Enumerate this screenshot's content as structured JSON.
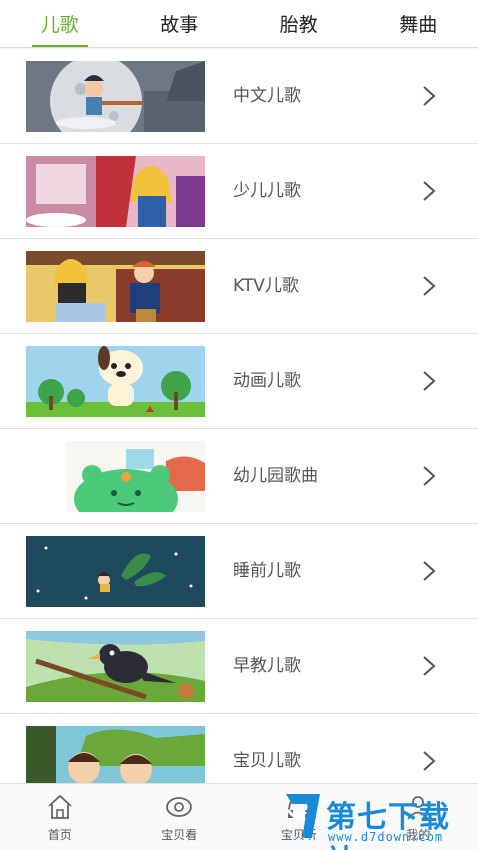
{
  "tabs": [
    {
      "label": "儿歌",
      "active": true
    },
    {
      "label": "故事",
      "active": false
    },
    {
      "label": "胎教",
      "active": false
    },
    {
      "label": "舞曲",
      "active": false
    }
  ],
  "list": [
    {
      "label": "中文儿歌",
      "thumb": "moon-night-thumbnail"
    },
    {
      "label": "少儿儿歌",
      "thumb": "princess-thumbnail"
    },
    {
      "label": "KTV儿歌",
      "thumb": "couple-thumbnail"
    },
    {
      "label": "动画儿歌",
      "thumb": "puppy-thumbnail"
    },
    {
      "label": "幼儿园歌曲",
      "thumb": "green-monster-thumbnail"
    },
    {
      "label": "睡前儿歌",
      "thumb": "crescent-moon-thumbnail"
    },
    {
      "label": "早教儿歌",
      "thumb": "crow-thumbnail"
    },
    {
      "label": "宝贝儿歌",
      "thumb": "kids-thumbnail"
    }
  ],
  "bottom_nav": [
    {
      "label": "首页",
      "icon": "home-icon"
    },
    {
      "label": "宝贝看",
      "icon": "eye-icon"
    },
    {
      "label": "宝贝听",
      "icon": "headphones-icon"
    },
    {
      "label": "我的",
      "icon": "user-icon"
    }
  ],
  "watermark": {
    "title": "第七下载站",
    "url": "www.d7down.com"
  },
  "colors": {
    "accent": "#6aae2f",
    "watermark": "#1a8ad6"
  }
}
